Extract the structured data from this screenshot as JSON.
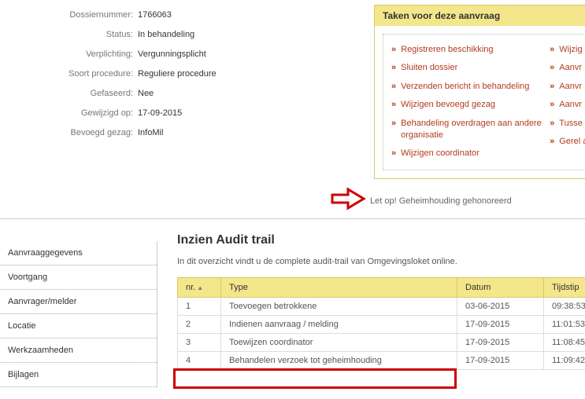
{
  "fields": {
    "dossiernummer": {
      "label": "Dossiernummer:",
      "value": "1766063"
    },
    "status": {
      "label": "Status:",
      "value": "In behandeling"
    },
    "verplichting": {
      "label": "Verplichting:",
      "value": "Vergunningsplicht"
    },
    "soortprocedure": {
      "label": "Soort procedure:",
      "value": "Reguliere procedure"
    },
    "gefaseerd": {
      "label": "Gefaseerd:",
      "value": "Nee"
    },
    "gewijzigdop": {
      "label": "Gewijzigd op:",
      "value": "17-09-2015"
    },
    "bevoegdgezag": {
      "label": "Bevoegd gezag:",
      "value": "InfoMil"
    }
  },
  "tasks": {
    "title": "Taken voor deze aanvraag",
    "left": [
      "Registreren beschikking",
      "Sluiten dossier",
      "Verzenden bericht in behandeling",
      "Wijzigen bevoegd gezag",
      "Behandeling overdragen aan andere organisatie",
      "Wijzigen coordinator"
    ],
    "right": [
      "Wijzig",
      "Aanvr",
      "Aanvr",
      "Aanvr",
      "Tusse archie",
      "Gerel aanvr"
    ]
  },
  "notice": "Let op! Geheimhouding gehonoreerd",
  "sidebar": {
    "items": [
      "Aanvraaggegevens",
      "Voortgang",
      "Aanvrager/melder",
      "Locatie",
      "Werkzaamheden",
      "Bijlagen"
    ]
  },
  "main": {
    "title": "Inzien Audit trail",
    "subtitle": "In dit overzicht vindt u de complete audit-trail van Omgevingsloket online.",
    "columns": {
      "nr": "nr.",
      "type": "Type",
      "datum": "Datum",
      "tijdstip": "Tijdstip"
    },
    "rows": [
      {
        "nr": "1",
        "type": "Toevoegen betrokkene",
        "datum": "03-06-2015",
        "tijd": "09:38:53"
      },
      {
        "nr": "2",
        "type": "Indienen aanvraag / melding",
        "datum": "17-09-2015",
        "tijd": "11:01:53"
      },
      {
        "nr": "3",
        "type": "Toewijzen coordinator",
        "datum": "17-09-2015",
        "tijd": "11:08:45"
      },
      {
        "nr": "4",
        "type": "Behandelen verzoek tot geheimhouding",
        "datum": "17-09-2015",
        "tijd": "11:09:42"
      }
    ]
  }
}
